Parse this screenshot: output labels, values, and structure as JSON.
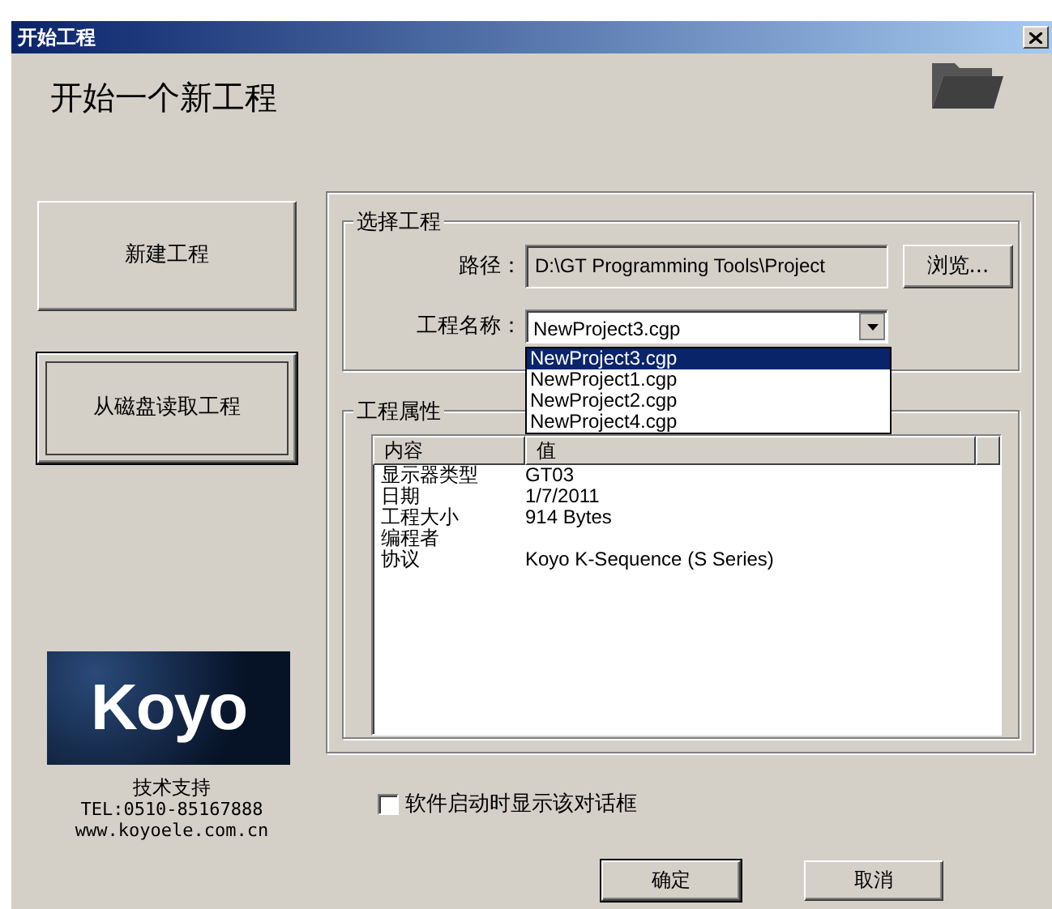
{
  "window": {
    "title": "开始工程"
  },
  "heading": "开始一个新工程",
  "left_buttons": [
    {
      "label": "新建工程",
      "selected": false
    },
    {
      "label": "从磁盘读取工程",
      "selected": true
    }
  ],
  "select_project": {
    "title": "选择工程",
    "path_label": "路径：",
    "path_value": "D:\\GT Programming Tools\\Project",
    "browse_button": "浏览...",
    "name_label": "工程名称：",
    "name_value": "NewProject3.cgp",
    "expanded": true,
    "options": [
      {
        "label": "NewProject3.cgp",
        "selected": true
      },
      {
        "label": "NewProject1.cgp",
        "selected": false
      },
      {
        "label": "NewProject2.cgp",
        "selected": false
      },
      {
        "label": "NewProject4.cgp",
        "selected": false
      }
    ]
  },
  "properties": {
    "title": "工程属性",
    "columns": [
      "内容",
      "值"
    ],
    "rows": [
      {
        "key": "显示器类型",
        "value": "GT03"
      },
      {
        "key": "日期",
        "value": "1/7/2011"
      },
      {
        "key": "工程大小",
        "value": "914 Bytes"
      },
      {
        "key": "编程者"
      },
      {
        "key": "协议",
        "value": "Koyo K-Sequence (S Series)"
      }
    ]
  },
  "logo": {
    "text": "Koyo"
  },
  "support": [
    "技术支持",
    "TEL:0510-85167888",
    "www.koyoele.com.cn"
  ],
  "startup_checkbox": {
    "label": "软件启动时显示该对话框",
    "checked": false
  },
  "buttons": [
    {
      "label": "确定",
      "default": true
    },
    {
      "label": "取消",
      "default": false
    }
  ]
}
